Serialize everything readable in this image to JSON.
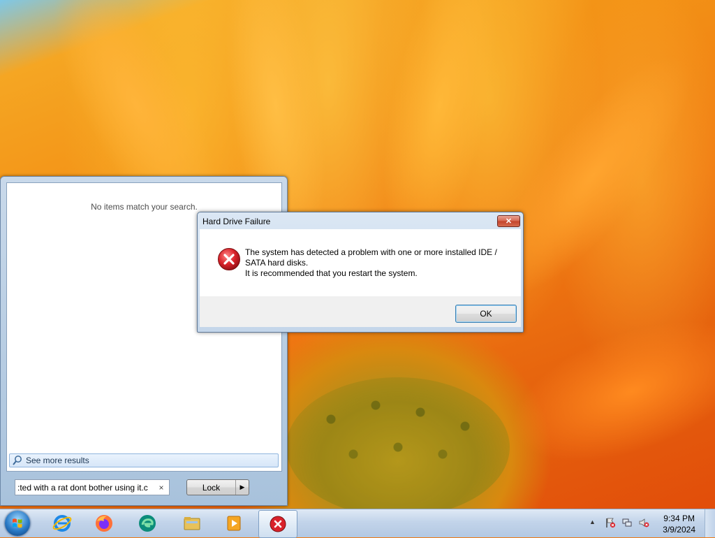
{
  "start_menu": {
    "no_results_text": "No items match your search.",
    "see_more_label": "See more results",
    "search_value": ":ted with a rat dont bother using it.c",
    "clear_glyph": "×",
    "lock_label": "Lock",
    "lock_arrow": "▶"
  },
  "dialog": {
    "title": "Hard Drive Failure",
    "close_glyph": "✕",
    "message_line1": "The system has detected a problem with one or more installed IDE /",
    "message_line2": "SATA hard disks.",
    "message_line3": "It is recommended that you restart the system.",
    "ok_label": "OK",
    "icon": "error-icon"
  },
  "taskbar": {
    "pinned": [
      "internet-explorer-icon",
      "firefox-icon",
      "edge-icon",
      "file-explorer-icon",
      "media-player-icon",
      "error-app-icon"
    ],
    "clock_time": "9:34 PM",
    "clock_date": "3/9/2024",
    "tray_chevron": "▲"
  },
  "colors": {
    "error_red": "#d9222a",
    "accent_blue": "#2a7ac6"
  }
}
